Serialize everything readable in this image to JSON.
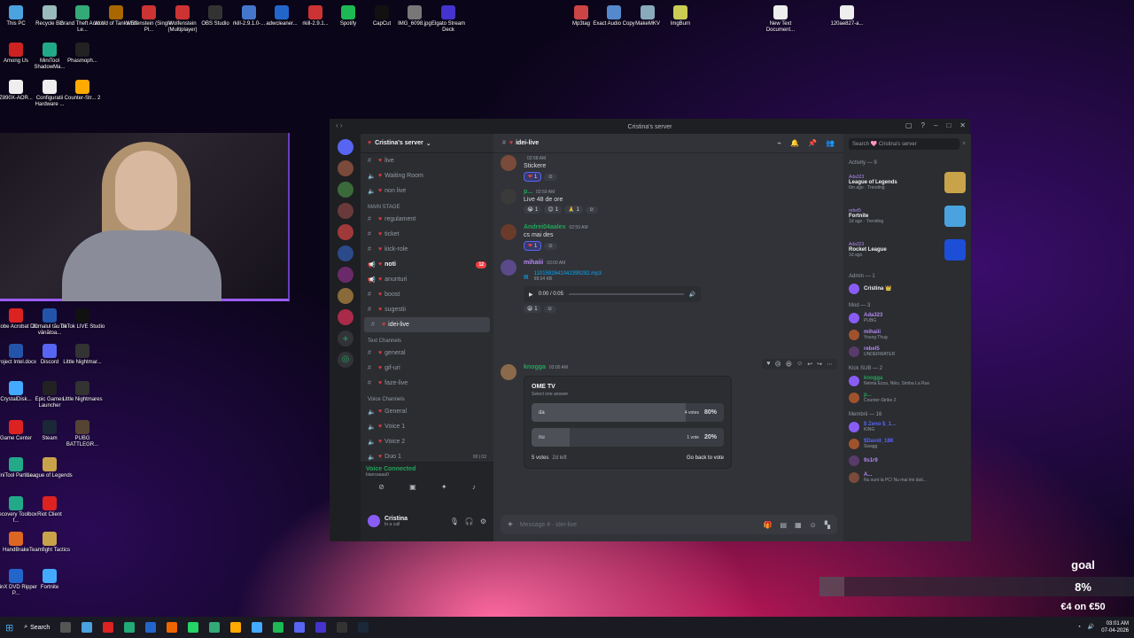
{
  "desktop_icons": [
    {
      "label": "This PC",
      "color": "#4aa3df"
    },
    {
      "label": "Recycle Bin",
      "color": "#9bb"
    },
    {
      "label": "Grand Theft Auto V Le...",
      "color": "#3a7"
    },
    {
      "label": "World of Tanks EU",
      "color": "#a60"
    },
    {
      "label": "Wolfenstein (Single Pl...",
      "color": "#c33"
    },
    {
      "label": "Wolfenstein (Multiplayer)",
      "color": "#c33"
    },
    {
      "label": "OBS Studio",
      "color": "#333"
    },
    {
      "label": "rkill-2.9.1.0-...",
      "color": "#47c"
    },
    {
      "label": "adwcleaner...",
      "color": "#26c"
    },
    {
      "label": "rkill-2.9.1...",
      "color": "#c33"
    },
    {
      "label": "Spotify",
      "color": "#1db954"
    },
    {
      "label": "CapCut",
      "color": "#111"
    },
    {
      "label": "IMG_6098.jpg",
      "color": "#777"
    },
    {
      "label": "Elgato Stream Deck",
      "color": "#43c"
    },
    {
      "label": "Mp3tag",
      "color": "#c44"
    },
    {
      "label": "Exact Audio Copy",
      "color": "#58c"
    },
    {
      "label": "MakeMKV",
      "color": "#8ab"
    },
    {
      "label": "ImgBurn",
      "color": "#cc5"
    },
    {
      "label": "New Text Document...",
      "color": "#eee"
    },
    {
      "label": "120ae827-a...",
      "color": "#eee"
    },
    {
      "label": "Among Us",
      "color": "#c22"
    },
    {
      "label": "MiniTool ShadowMa...",
      "color": "#2a8"
    },
    {
      "label": "Phasmoph...",
      "color": "#222"
    },
    {
      "label": "Z890X-AOR...",
      "color": "#eee"
    },
    {
      "label": "Configuratii Hardware ...",
      "color": "#eee"
    },
    {
      "label": "Counter-Str... 2",
      "color": "#fa0"
    },
    {
      "label": "Adobe Acrobat DC",
      "color": "#d22"
    },
    {
      "label": "Jurnalul tău de vânătoa...",
      "color": "#25a"
    },
    {
      "label": "TikTok LIVE Studio",
      "color": "#111"
    },
    {
      "label": "Project Intel.docx",
      "color": "#25a"
    },
    {
      "label": "Discord",
      "color": "#5865f2"
    },
    {
      "label": "Little Nightmar...",
      "color": "#333"
    },
    {
      "label": "CrystalDisk...",
      "color": "#4af"
    },
    {
      "label": "Epic Games Launcher",
      "color": "#222"
    },
    {
      "label": "Little Nightmares",
      "color": "#333"
    },
    {
      "label": "Game Center",
      "color": "#d22"
    },
    {
      "label": "Steam",
      "color": "#1b2838"
    },
    {
      "label": "PUBG BATTLEGR...",
      "color": "#543"
    },
    {
      "label": "MiniTool Partitio...",
      "color": "#2a8"
    },
    {
      "label": "League of Legends",
      "color": "#c9a34a"
    },
    {
      "label": "Recovery Toolbox f...",
      "color": "#2a8"
    },
    {
      "label": "Riot Client",
      "color": "#d22"
    },
    {
      "label": "HandBrake",
      "color": "#d62"
    },
    {
      "label": "Teamfight Tactics",
      "color": "#c9a34a"
    },
    {
      "label": "WinX DVD Ripper P...",
      "color": "#26c"
    },
    {
      "label": "Fortnite",
      "color": "#4af"
    }
  ],
  "window": {
    "title": "Cristina's server"
  },
  "server": {
    "name": "Cristina's server"
  },
  "channels_top": [
    {
      "name": "live",
      "sym": "#"
    },
    {
      "name": "Waiting Room",
      "sym": "🔈"
    },
    {
      "name": "non live",
      "sym": "🔈"
    }
  ],
  "main_stage": {
    "label": "MAIN STAGE",
    "items": [
      {
        "name": "regulament",
        "sym": "#"
      },
      {
        "name": "ticket",
        "sym": "#"
      },
      {
        "name": "kick-role",
        "sym": "#"
      },
      {
        "name": "noti",
        "sym": "📢",
        "badge": "12"
      },
      {
        "name": "anunturi",
        "sym": "📢"
      },
      {
        "name": "boost",
        "sym": "#"
      },
      {
        "name": "sugestii",
        "sym": "#"
      },
      {
        "name": "idei-live",
        "sym": "#"
      }
    ]
  },
  "text_channels": {
    "label": "Text Channels",
    "items": [
      {
        "name": "general"
      },
      {
        "name": "gif-uri"
      },
      {
        "name": "faze-live"
      }
    ]
  },
  "voice_channels": {
    "label": "Voice Channels",
    "items": [
      {
        "name": "General"
      },
      {
        "name": "Voice 1"
      },
      {
        "name": "Voice 2"
      },
      {
        "name": "Duo 1",
        "users": "00",
        "limit": "02"
      }
    ]
  },
  "voice": {
    "status": "Voice Connected",
    "server": "biancaaaa0"
  },
  "user": {
    "name": "Cristina",
    "status": "In a call"
  },
  "chat": {
    "channel": "idei-live",
    "composer_placeholder": "Message #  ·  idei-live"
  },
  "messages": [
    {
      "author": "",
      "time": "02:58 AM",
      "text": "Stickere",
      "color": "#f0b232",
      "reactions": [
        {
          "e": "❤",
          "n": "1"
        }
      ]
    },
    {
      "author": "p...",
      "time": "02:59 AM",
      "text": "Live 48 de ore",
      "color": "#23a55a",
      "reactions": [
        {
          "e": "😭",
          "n": "1"
        },
        {
          "e": "😊",
          "n": "1"
        },
        {
          "e": "🙏",
          "n": "1"
        }
      ]
    },
    {
      "author": "Andrei04aalex",
      "time": "02:59 AM",
      "text": "cs mai des",
      "color": "#23a55a",
      "reactions": [
        {
          "e": "❤",
          "n": "1"
        }
      ]
    },
    {
      "author": "mihaiii",
      "time": "03:00 AM",
      "text": "",
      "color": "#b389f2",
      "file": "1101592641042399292.mp3",
      "size": "98.04 KB",
      "audio_time": "0:00 / 0:05",
      "reactions": [
        {
          "e": "😆",
          "n": "1"
        }
      ]
    },
    {
      "author": "knogga",
      "time": "03:00 AM",
      "color": "#23a55a"
    }
  ],
  "poll": {
    "question": "OME TV",
    "hint": "Select one answer",
    "options": [
      {
        "label": "da",
        "votes": "4 votes",
        "pct": "80%",
        "value": 0.8
      },
      {
        "label": "nu",
        "votes": "1 vote",
        "pct": "20%",
        "value": 0.2
      }
    ],
    "total": "5 votes",
    "left": "2d left",
    "back": "Go back to vote"
  },
  "members": {
    "search_placeholder": "Search 🩷 Cristina's server",
    "activity_label": "Activity — 9",
    "activities": [
      {
        "user": "Ada323",
        "title": "League of Legends",
        "sub": "6m ago · Trending",
        "color": "#c9a34a"
      },
      {
        "user": "rebel5",
        "title": "Fortnite",
        "sub": "1d ago · Trending",
        "color": "#4aa3df"
      },
      {
        "user": "Ada323",
        "title": "Rocket League",
        "sub": "1d ago",
        "color": "#1d4ed8"
      }
    ],
    "groups": [
      {
        "label": "Admin — 1",
        "members": [
          {
            "name": "Cristina 👑",
            "sub": "",
            "color": "#f2f3f5"
          }
        ]
      },
      {
        "label": "Mod — 3",
        "members": [
          {
            "name": "Ada323",
            "sub": "PUBG",
            "color": "#b389f2"
          },
          {
            "name": "mihaiii",
            "sub": "Young Thug",
            "color": "#b389f2"
          },
          {
            "name": "rebel5",
            "sub": "UNDERWATER",
            "color": "#b389f2"
          }
        ]
      },
      {
        "label": "Kick SUB — 2",
        "members": [
          {
            "name": "knogga",
            "sub": "Neima Ezza, Niko, Simba La Rue",
            "color": "#23a55a"
          },
          {
            "name": "p...",
            "sub": "Counter-Strike 2",
            "color": "#23a55a"
          }
        ]
      },
      {
        "label": "Membrii — 16",
        "members": [
          {
            "name": "$ Zeno $_1...",
            "sub": "KING",
            "color": "#5865f2"
          },
          {
            "name": "$David_18K",
            "sub": "Swagg",
            "color": "#5865f2"
          },
          {
            "name": "9s1r9",
            "sub": "",
            "color": "#b389f2"
          },
          {
            "name": "A...",
            "sub": "Nu sunt la PC! Nu mai imi dati...",
            "color": "#b389f2"
          }
        ]
      }
    ]
  },
  "overlay": {
    "goal_label": "goal",
    "percent_text": "8%",
    "percent": 0.08,
    "amount": "€4 on €50"
  },
  "taskbar": {
    "search": "Search",
    "time": "03:01 AM",
    "date": "07-04-2026"
  }
}
